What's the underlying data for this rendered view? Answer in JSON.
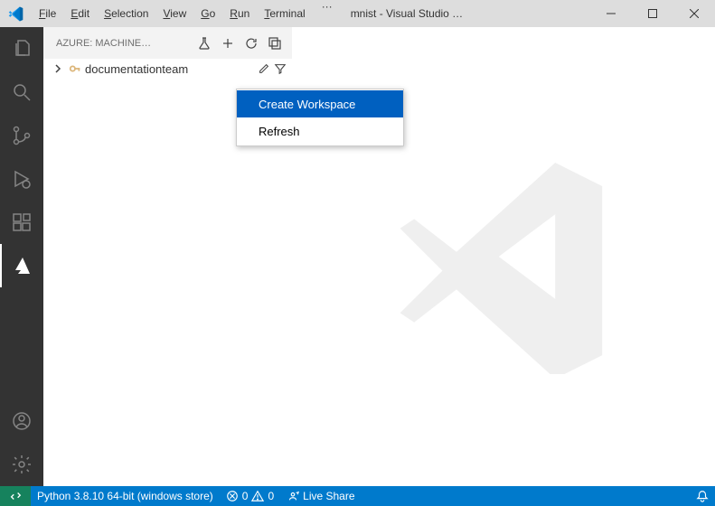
{
  "titlebar": {
    "menus": {
      "file": "File",
      "edit": "Edit",
      "selection": "Selection",
      "view": "View",
      "go": "Go",
      "run": "Run",
      "terminal": "Terminal"
    },
    "title": "mnist - Visual Studio …"
  },
  "sidebar": {
    "title": "AZURE: MACHINE…",
    "tree": {
      "item_label": "documentationteam"
    }
  },
  "context_menu": {
    "create_workspace": "Create Workspace",
    "refresh": "Refresh"
  },
  "statusbar": {
    "python": "Python 3.8.10 64-bit (windows store)",
    "errors": "0",
    "warnings": "0",
    "live_share": "Live Share"
  }
}
